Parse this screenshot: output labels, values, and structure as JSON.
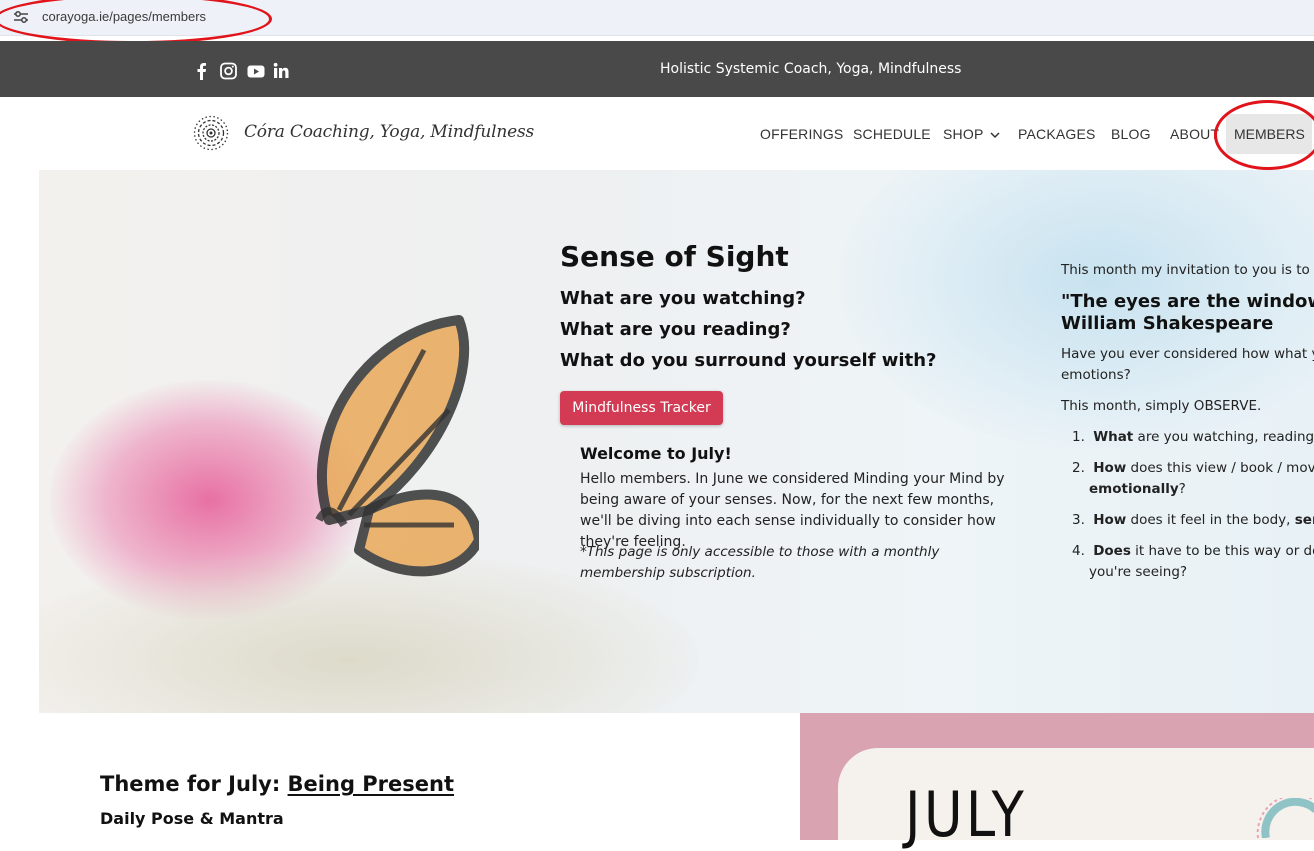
{
  "browser": {
    "url": "corayoga.ie/pages/members"
  },
  "topbar": {
    "tagline": "Holistic Systemic Coach, Yoga, Mindfulness",
    "social": [
      "facebook-icon",
      "instagram-icon",
      "youtube-icon",
      "linkedin-icon"
    ]
  },
  "header": {
    "logo_text": "Córa Coaching, Yoga, Mindfulness",
    "nav": [
      {
        "label": "OFFERINGS"
      },
      {
        "label": "SCHEDULE"
      },
      {
        "label": "SHOP"
      },
      {
        "label": "PACKAGES"
      },
      {
        "label": "BLOG"
      },
      {
        "label": "ABOUT"
      },
      {
        "label": "MEMBERS"
      }
    ]
  },
  "hero": {
    "title": "Sense of Sight",
    "questions": [
      "What are you watching?",
      "What are you reading?",
      "What do you surround yourself with?"
    ],
    "button": "Mindfulness Tracker",
    "welcome_title": "Welcome to July!",
    "welcome_text": "Hello members. In June we considered Minding your Mind by being aware of your senses. Now, for the next few months, we'll be diving into each sense individually to consider how they're feeling.",
    "note": "*This page is only accessible to those with a monthly membership subscription."
  },
  "right_column": {
    "intro": "This month my invitation to you is to n",
    "quote_line1": "\"The eyes are the windows t",
    "quote_line2": "William Shakespeare",
    "para1_line1": "Have you ever considered how what yo",
    "para1_line2": "emotions?",
    "para2": "This month, simply OBSERVE.",
    "list": [
      {
        "num": "1.",
        "bold": "What",
        "rest": " are you watching, reading, l"
      },
      {
        "num": "2.",
        "bold": "How",
        "rest": " does this view / book / movie",
        "line2_bold": "emotionally",
        "line2_rest": "?"
      },
      {
        "num": "3.",
        "bold": "How",
        "rest": " does it feel in the body, ",
        "bold2": "sensa"
      },
      {
        "num": "4.",
        "bold": "Does",
        "rest": " it have to be this way or do y",
        "line2_rest": "you're seeing?"
      }
    ]
  },
  "lower": {
    "theme_prefix": "Theme for July: ",
    "theme_link": "Being Present",
    "daily": "Daily Pose & Mantra",
    "card_text": "JULY"
  },
  "colors": {
    "topstrip": "#494949",
    "button": "#d33a54",
    "pink_panel": "#d9a3b1",
    "annotation": "#e1131b"
  }
}
